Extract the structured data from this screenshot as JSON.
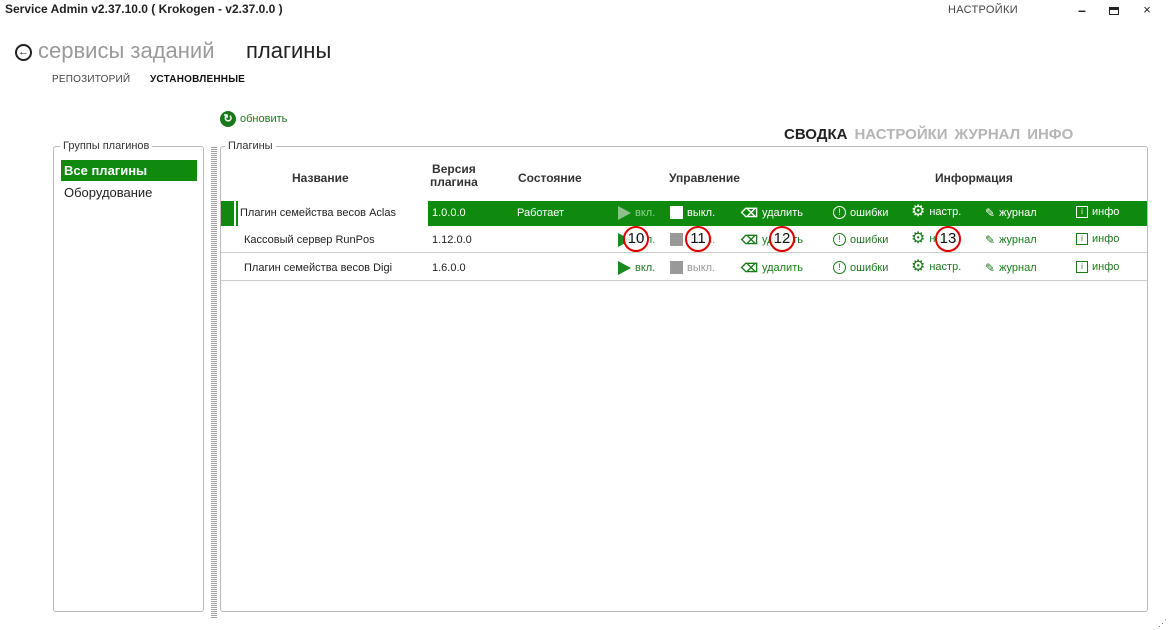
{
  "window": {
    "title": "Service Admin  v2.37.10.0  ( Krokogen - v2.37.0.0 )",
    "settings_label": "НАСТРОЙКИ",
    "minimize": "–",
    "close": "×"
  },
  "breadcrumb": {
    "parent": "сервисы заданий",
    "current": "плагины"
  },
  "subtabs": {
    "repository": "РЕПОЗИТОРИЙ",
    "installed": "УСТАНОВЛЕННЫЕ"
  },
  "toolbar": {
    "refresh_label": "обновить"
  },
  "view_tabs": [
    "СВОДКА",
    "НАСТРОЙКИ",
    "ЖУРНАЛ",
    "ИНФО"
  ],
  "groups": {
    "legend": "Группы плагинов",
    "items": [
      {
        "label": "Все плагины",
        "active": true
      },
      {
        "label": "Оборудование",
        "active": false
      }
    ]
  },
  "plugins": {
    "legend": "Плагины",
    "headers": {
      "name": "Название",
      "version": "Версия\nплагина",
      "state": "Состояние",
      "control": "Управление",
      "info": "Информация"
    },
    "actions": {
      "on": "вкл.",
      "off": "выкл.",
      "delete": "удалить",
      "errors": "ошибки",
      "settings": "настр.",
      "journal": "журнал",
      "info": "инфо"
    },
    "rows": [
      {
        "name": "Плагин семейства весов Aclas",
        "version": "1.0.0.0",
        "state": "Работает",
        "selected": true
      },
      {
        "name": "Кассовый сервер RunPos",
        "version": "1.12.0.0",
        "state": "",
        "selected": false
      },
      {
        "name": "Плагин семейства весов Digi",
        "version": "1.6.0.0",
        "state": "",
        "selected": false
      }
    ]
  },
  "callouts": [
    "10",
    "11",
    "12",
    "13"
  ],
  "colors": {
    "accent_green": "#0f8a0f",
    "link_green": "#1a7a1a",
    "callout_red": "#dd0000"
  }
}
